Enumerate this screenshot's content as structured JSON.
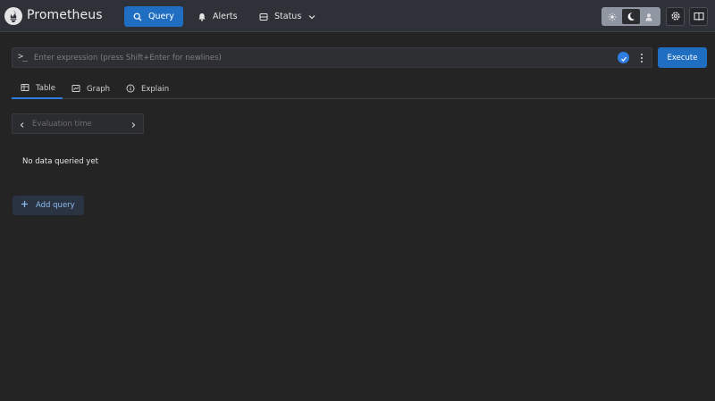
{
  "header": {
    "app_title": "Prometheus",
    "nav": [
      {
        "label": "Query",
        "icon": "search-icon",
        "active": true
      },
      {
        "label": "Alerts",
        "icon": "bell-icon",
        "active": false
      },
      {
        "label": "Status",
        "icon": "server-icon",
        "active": false,
        "has_dropdown": true
      }
    ],
    "theme_options": [
      "light",
      "dark",
      "auto"
    ],
    "theme_selected": "dark",
    "settings_icon": "gear-icon",
    "docs_icon": "book-icon"
  },
  "query": {
    "prompt_symbol": ">_",
    "expression_value": "",
    "expression_placeholder": "Enter expression (press Shift+Enter for newlines)",
    "execute_label": "Execute"
  },
  "tabs": [
    {
      "label": "Table",
      "icon": "table-icon",
      "active": true
    },
    {
      "label": "Graph",
      "icon": "chart-icon",
      "active": false
    },
    {
      "label": "Explain",
      "icon": "info-icon",
      "active": false
    }
  ],
  "evaluation": {
    "value": "",
    "placeholder": "Evaluation time"
  },
  "results": {
    "empty_message": "No data queried yet"
  },
  "add_query_label": "Add query",
  "colors": {
    "accent": "#1f6ec2",
    "header_bg": "#2e3137",
    "page_bg": "#242424",
    "link_text": "#8ebcf1"
  }
}
